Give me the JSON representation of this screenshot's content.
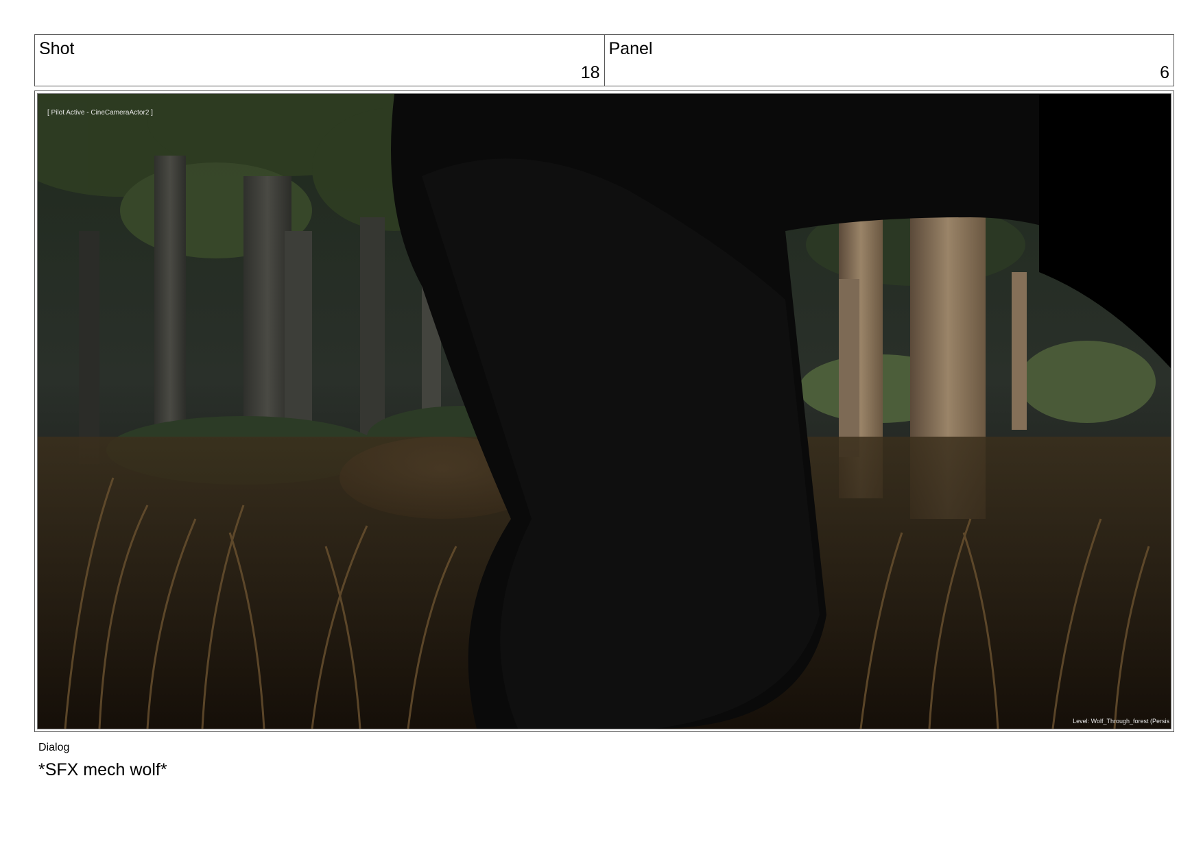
{
  "header": {
    "shot_label": "Shot",
    "shot_number": "18",
    "panel_label": "Panel",
    "panel_number": "6"
  },
  "viewport": {
    "pilot_text": "[ Pilot Active - CineCameraActor2 ]",
    "level_text": "Level:  Wolf_Through_forest (Persis"
  },
  "dialog": {
    "label": "Dialog",
    "text": "*SFX mech wolf*"
  }
}
